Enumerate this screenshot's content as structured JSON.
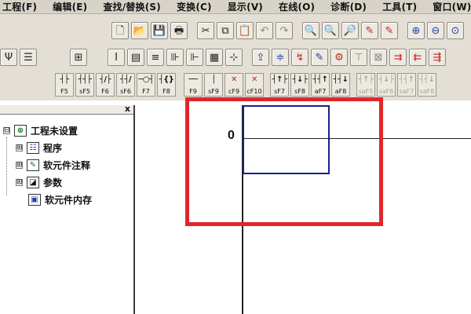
{
  "menubar": {
    "items": [
      "工程(F)",
      "编辑(E)",
      "查找/替换(S)",
      "变换(C)",
      "显示(V)",
      "在线(O)",
      "诊断(D)",
      "工具(T)",
      "窗口(W)"
    ]
  },
  "toolbar_row1": {
    "file": [
      "new-icon",
      "open-icon",
      "save-icon",
      "print-icon"
    ],
    "edit": [
      "cut-icon",
      "copy-icon",
      "paste-icon",
      "undo-icon",
      "redo-icon"
    ],
    "find": [
      "find-device-icon",
      "find-instruction-icon",
      "find-step-icon",
      "replace-icon",
      "replace-step-icon"
    ],
    "zoom": [
      "zoom-in-icon",
      "zoom-out-icon",
      "zoom-fit-icon"
    ]
  },
  "ladder_keys": [
    {
      "symbol": "┤├",
      "label": "F5"
    },
    {
      "symbol": "┤┤├",
      "label": "sF5"
    },
    {
      "symbol": "┤/├",
      "label": "F6"
    },
    {
      "symbol": "┤┤/",
      "label": "sF6"
    },
    {
      "symbol": "─○┤",
      "label": "F7"
    },
    {
      "symbol": "┤{}",
      "label": "F8"
    },
    {
      "symbol": "──",
      "label": "F9"
    },
    {
      "symbol": "│",
      "label": "sF9"
    },
    {
      "symbol": "✕",
      "label": "cF9"
    },
    {
      "symbol": "✕",
      "label": "cF10"
    },
    {
      "symbol": "┤↑├",
      "label": "sF7"
    },
    {
      "symbol": "┤↓├",
      "label": "sF8"
    },
    {
      "symbol": "┤┤↑",
      "label": "aF7"
    },
    {
      "symbol": "┤┤↓",
      "label": "aF8"
    },
    {
      "symbol": "┤↑├",
      "label": "saF5"
    },
    {
      "symbol": "┤↓├",
      "label": "saF6"
    },
    {
      "symbol": "┤┤↑",
      "label": "saF7"
    },
    {
      "symbol": "┤┤↓",
      "label": "saF8"
    }
  ],
  "project_pane": {
    "close": "x",
    "root": "工程未设置",
    "items": [
      {
        "label": "程序",
        "expander": "⊞"
      },
      {
        "label": "软元件注释",
        "expander": "⊞"
      },
      {
        "label": "参数",
        "expander": "⊞"
      },
      {
        "label": "软元件内存",
        "expander": ""
      }
    ],
    "root_expander": "⊟"
  },
  "ladder": {
    "step_number": "0"
  },
  "colors": {
    "cursor": "#13238a",
    "highlight": "#e0262a",
    "toolbar_bg": "#e3dfd5"
  }
}
